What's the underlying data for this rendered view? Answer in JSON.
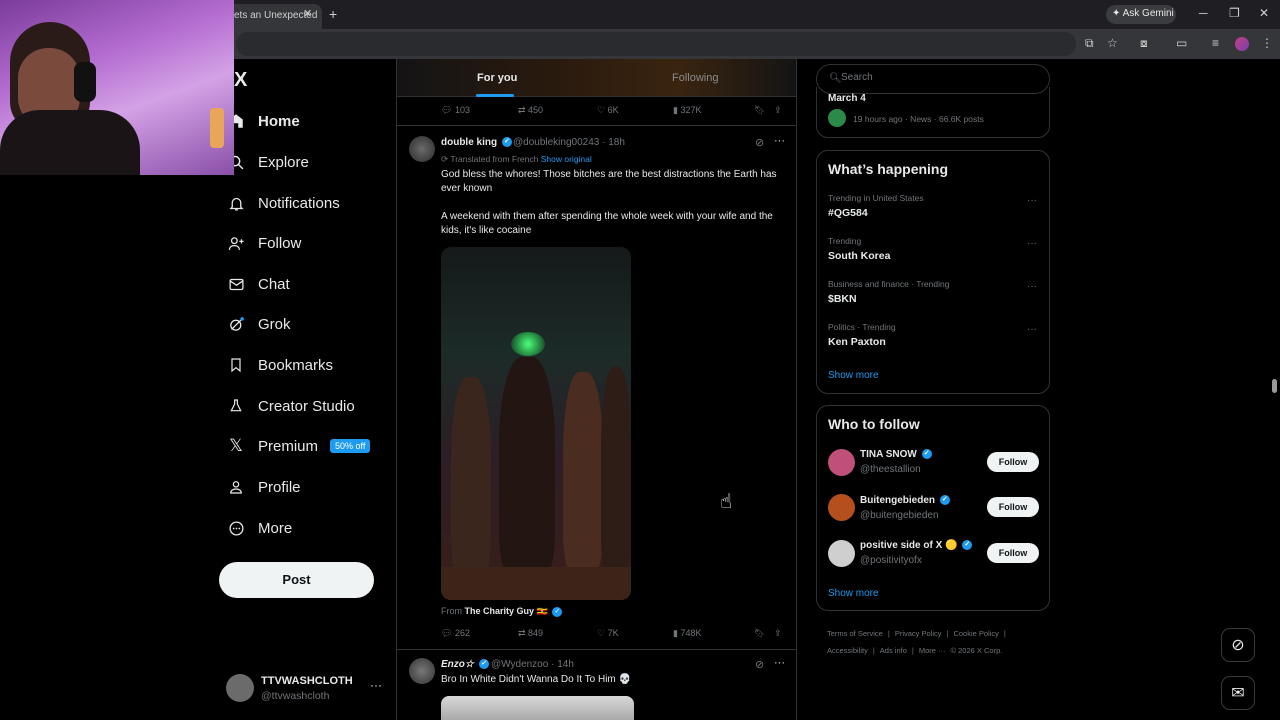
{
  "browser": {
    "tab_title": "ets an Unexpected",
    "tab_close": "✕",
    "new_tab": "+",
    "gemini_label": "✦ Ask Gemini",
    "win_min": "─",
    "win_max": "❐",
    "win_close": "✕"
  },
  "sidebar": {
    "logo": "X",
    "items": [
      {
        "label": "Home",
        "icon": "home-icon"
      },
      {
        "label": "Explore",
        "icon": "search-icon"
      },
      {
        "label": "Notifications",
        "icon": "bell-icon"
      },
      {
        "label": "Follow",
        "icon": "add-user-icon"
      },
      {
        "label": "Chat",
        "icon": "mail-icon"
      },
      {
        "label": "Grok",
        "icon": "grok-icon"
      },
      {
        "label": "Bookmarks",
        "icon": "bookmark-icon"
      },
      {
        "label": "Creator Studio",
        "icon": "flask-icon"
      },
      {
        "label": "Premium",
        "icon": "x-icon"
      },
      {
        "label": "Profile",
        "icon": "person-icon"
      },
      {
        "label": "More",
        "icon": "more-circle-icon"
      }
    ],
    "premium_badge": "50% off",
    "post_label": "Post",
    "account": {
      "name": "TTVWASHCLOTH",
      "handle": "@ttvwashcloth",
      "more": "···"
    }
  },
  "feed": {
    "tabs": {
      "for_you": "For you",
      "following": "Following"
    },
    "prev_actions": {
      "replies": "103",
      "reposts": "450",
      "likes": "6K",
      "views": "327K"
    },
    "tweet1": {
      "name": "double king",
      "handle": "@doubleking00243",
      "time": "· 18h",
      "translated": "Translated from French",
      "show_original": "Show original",
      "text1": "God bless the whores! Those bitches are the best distractions the Earth has ever known",
      "text2": "A weekend with them after spending the whole week with your wife and the kids, it's like cocaine",
      "from_prefix": "From",
      "from_name": "The Charity Guy 🇺🇬",
      "replies": "262",
      "reposts": "849",
      "likes": "7K",
      "views": "748K"
    },
    "tweet2": {
      "name": "Enzo☆",
      "handle": "@Wydenzoo",
      "time": "· 14h",
      "text": "Bro In White Didn't Wanna Do It To Him 💀"
    }
  },
  "right": {
    "search_placeholder": "Search",
    "top_card": {
      "title": "March 4",
      "meta": "19 hours ago · News · 66.6K posts"
    },
    "happening": {
      "title": "What’s happening",
      "trends": [
        {
          "meta": "Trending in United States",
          "name": "#QG584"
        },
        {
          "meta": "Trending",
          "name": "South Korea"
        },
        {
          "meta": "Business and finance · Trending",
          "name": "$BKN"
        },
        {
          "meta": "Politics · Trending",
          "name": "Ken Paxton"
        }
      ],
      "show_more": "Show more"
    },
    "who_to_follow": {
      "title": "Who to follow",
      "users": [
        {
          "name": "TINA SNOW",
          "handle": "@theestallion",
          "avatar_color": "#c0507a"
        },
        {
          "name": "Buitengebieden",
          "handle": "@buitengebieden",
          "avatar_color": "#b5501e"
        },
        {
          "name": "positive side of X 🟡",
          "handle": "@positivityofx",
          "avatar_color": "#cfcfcf"
        }
      ],
      "follow_label": "Follow",
      "show_more": "Show more"
    },
    "footer": [
      "Terms of Service",
      "|",
      "Privacy Policy",
      "|",
      "Cookie Policy",
      "|",
      "Accessibility",
      "|",
      "Ads info",
      "|",
      "More ···",
      "© 2026 X Corp."
    ]
  },
  "colors": {
    "accent": "#1d9bf0",
    "background": "#000000",
    "text": "#e7e9ea",
    "muted": "#71767b"
  }
}
